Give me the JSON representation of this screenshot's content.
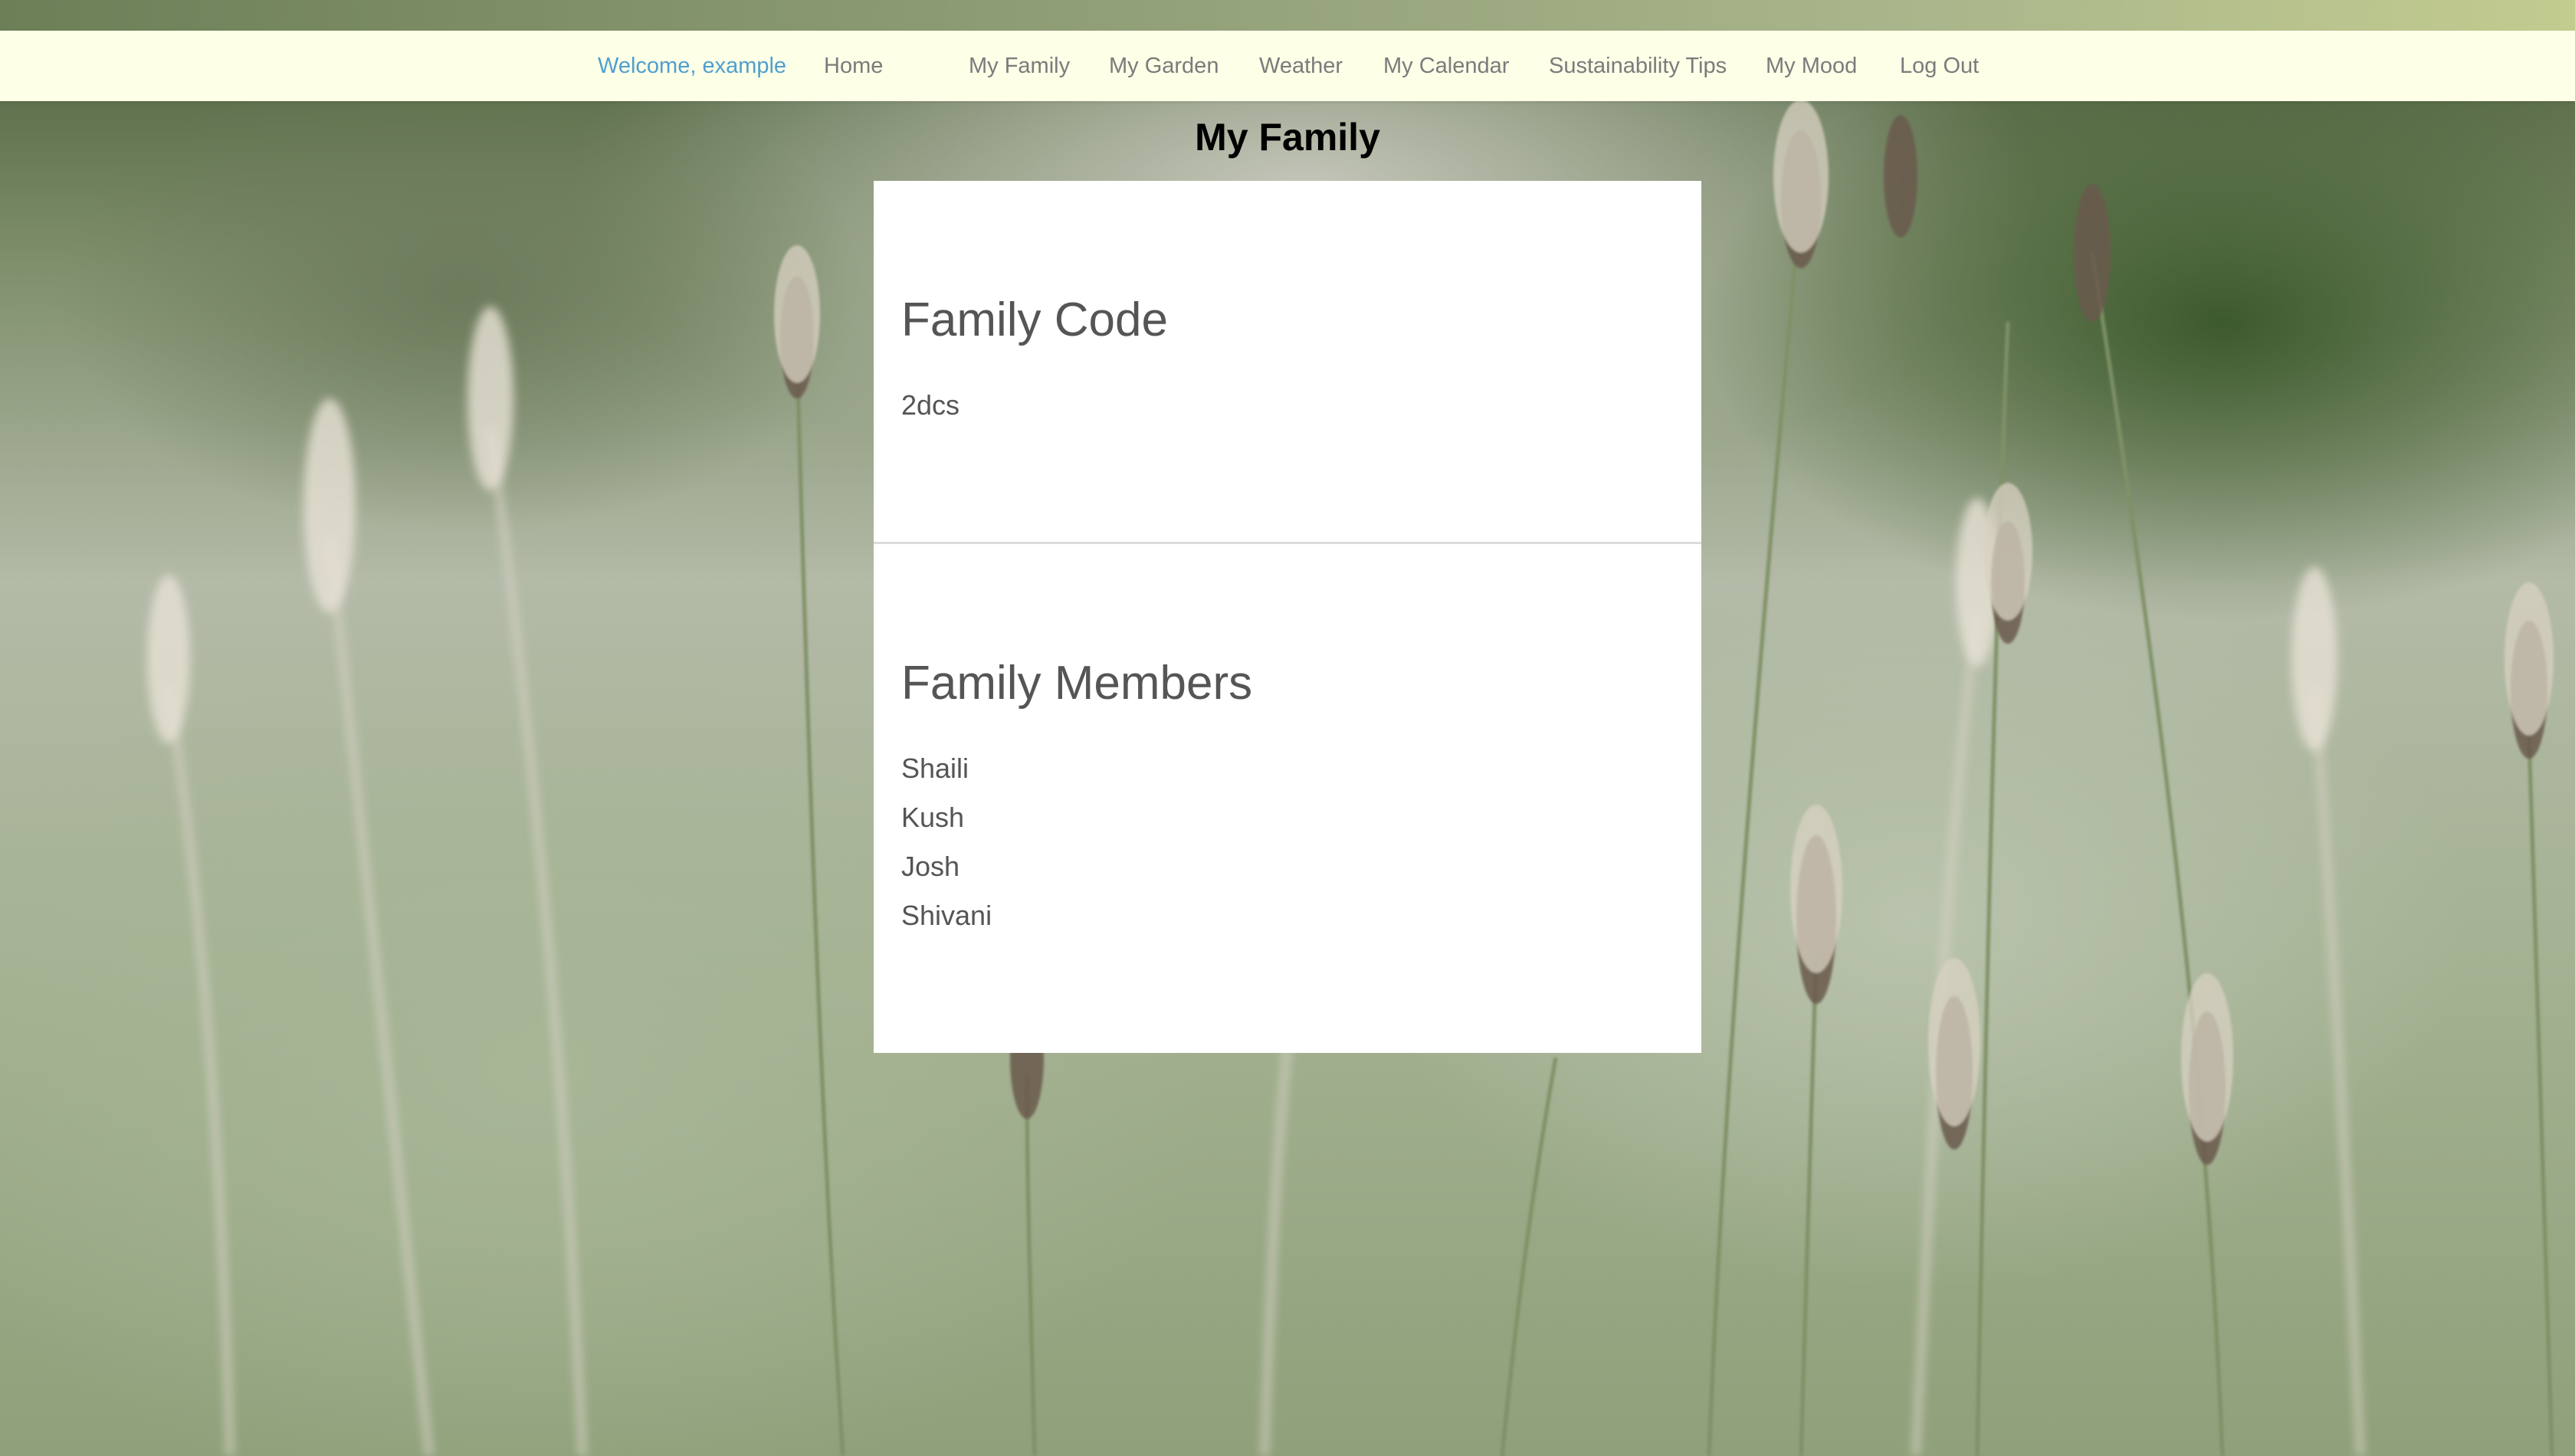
{
  "nav": {
    "welcome": "Welcome, example",
    "items": [
      {
        "label": "Home"
      },
      {
        "label": "My Family"
      },
      {
        "label": "My Garden"
      },
      {
        "label": "Weather"
      },
      {
        "label": "My Calendar"
      },
      {
        "label": "Sustainability Tips"
      },
      {
        "label": "My Mood"
      },
      {
        "label": "Log Out"
      }
    ]
  },
  "page": {
    "title": "My Family"
  },
  "family_code": {
    "heading": "Family Code",
    "value": "2dcs"
  },
  "family_members": {
    "heading": "Family Members",
    "members": [
      "Shaili",
      "Kush",
      "Josh",
      "Shivani"
    ]
  },
  "colors": {
    "navbar_bg": "#fdffe7",
    "welcome_text": "#4f9fd0",
    "nav_text": "#7b7b7b",
    "card_text": "#555555"
  }
}
